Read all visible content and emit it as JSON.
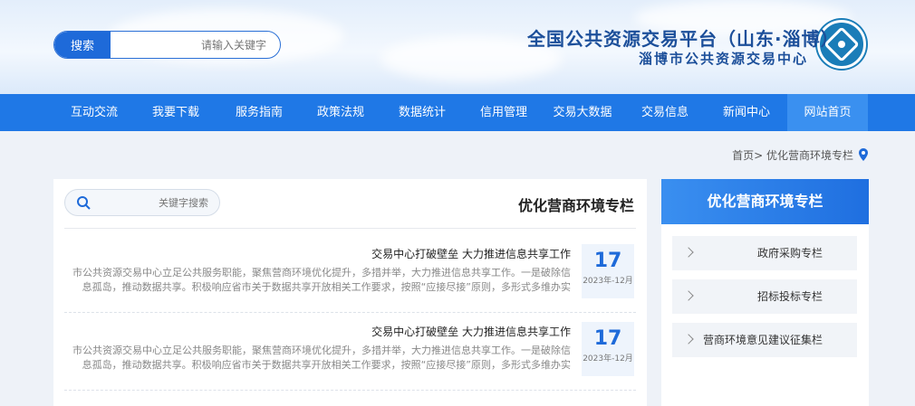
{
  "header": {
    "title": "全国公共资源交易平台（山东·淄博）",
    "subtitle": "淄博市公共资源交易中心",
    "search": {
      "placeholder": "请输入关键字",
      "button": "搜索"
    }
  },
  "nav": {
    "items": [
      {
        "label": "网站首页",
        "active": true
      },
      {
        "label": "新闻中心"
      },
      {
        "label": "交易信息"
      },
      {
        "label": "交易大数据"
      },
      {
        "label": "信用管理"
      },
      {
        "label": "数据统计"
      },
      {
        "label": "政策法规"
      },
      {
        "label": "服务指南"
      },
      {
        "label": "我要下载"
      },
      {
        "label": "互动交流"
      }
    ]
  },
  "breadcrumb": {
    "text": "首页> 优化营商环境专栏"
  },
  "main": {
    "title": "优化营商环境专栏",
    "search_placeholder": "关键字搜索",
    "news": [
      {
        "day": "17",
        "ym": "2023年-12月",
        "title": "交易中心打破壁垒 大力推进信息共享工作",
        "summary": "市公共资源交易中心立足公共服务职能，聚焦营商环境优化提升，多措并举，大力推进信息共享工作。一是破除信息孤岛，推动数据共享。积极响应省市关于数据共享开放相关工作要求，按照“应接尽接”原则，多形式多维办实现交易..."
      },
      {
        "day": "17",
        "ym": "2023年-12月",
        "title": "交易中心打破壁垒 大力推进信息共享工作",
        "summary": "市公共资源交易中心立足公共服务职能，聚焦营商环境优化提升，多措并举，大力推进信息共享工作。一是破除信息孤岛，推动数据共享。积极响应省市关于数据共享开放相关工作要求，按照“应接尽接”原则，多形式多维办实现交易..."
      }
    ]
  },
  "sidebar": {
    "title": "优化营商环境专栏",
    "items": [
      {
        "label": "政府采购专栏"
      },
      {
        "label": "招标投标专栏"
      },
      {
        "label": "营商环境意见建议征集栏"
      }
    ]
  },
  "colors": {
    "nav_bg": "#1f78e6",
    "accent": "#1e6ad9",
    "title_color": "#1c4f9a"
  }
}
